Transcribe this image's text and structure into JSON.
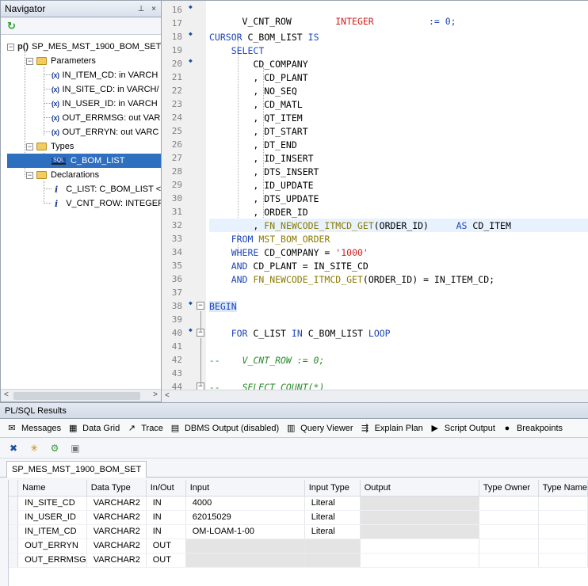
{
  "navigator": {
    "title": "Navigator",
    "pin_glyph": "⊥",
    "close_glyph": "×",
    "root": "SP_MES_MST_1900_BOM_SET",
    "root_icon": "p()",
    "param_icon": "(x)",
    "sql_icon": "SQL",
    "info_icon": "i",
    "parameters_label": "Parameters",
    "params": [
      "IN_ITEM_CD: in VARCH",
      "IN_SITE_CD: in VARCH/",
      "IN_USER_ID: in VARCH",
      "OUT_ERRMSG: out VAR",
      "OUT_ERRYN: out VARC"
    ],
    "types_label": "Types",
    "type_item": "C_BOM_LIST",
    "declarations_label": "Declarations",
    "decls": [
      "C_LIST: C_BOM_LIST <",
      "V_CNT_ROW: INTEGER"
    ]
  },
  "editor": {
    "lines": [
      {
        "n": "16",
        "bp": true
      },
      {
        "n": "17"
      },
      {
        "n": "18",
        "bp": true
      },
      {
        "n": "19"
      },
      {
        "n": "20",
        "bp": true
      },
      {
        "n": "21"
      },
      {
        "n": "22"
      },
      {
        "n": "23"
      },
      {
        "n": "24"
      },
      {
        "n": "25"
      },
      {
        "n": "26"
      },
      {
        "n": "27"
      },
      {
        "n": "28"
      },
      {
        "n": "29"
      },
      {
        "n": "30"
      },
      {
        "n": "31"
      },
      {
        "n": "32"
      },
      {
        "n": "33"
      },
      {
        "n": "34"
      },
      {
        "n": "35"
      },
      {
        "n": "36"
      },
      {
        "n": "37"
      },
      {
        "n": "38",
        "bp": true,
        "fold": "-"
      },
      {
        "n": "39"
      },
      {
        "n": "40",
        "bp": true,
        "fold": "-"
      },
      {
        "n": "41"
      },
      {
        "n": "42"
      },
      {
        "n": "43"
      },
      {
        "n": "44",
        "fold": "-"
      }
    ],
    "code": {
      "l16_var": "V_CNT_ROW",
      "l16_type": "INTEGER",
      "l16_assign": ":= 0;",
      "l18_kw": "CURSOR",
      "l18_name": "C_BOM_LIST",
      "l18_is": "IS",
      "l19": "SELECT",
      "l20": "CD_COMPANY",
      "cols": [
        ", CD_PLANT",
        ", NO_SEQ",
        ", CD_MATL",
        ", QT_ITEM",
        ", DT_START",
        ", DT_END",
        ", ID_INSERT",
        ", DTS_INSERT",
        ", ID_UPDATE",
        ", DTS_UPDATE",
        ", ORDER_ID"
      ],
      "l32_comma": ",",
      "l32_fn": "FN_NEWCODE_ITMCD_GET",
      "l32_arg": "(ORDER_ID)",
      "l32_as": "AS",
      "l32_alias": "CD_ITEM",
      "l33_kw": "FROM",
      "l33_tbl": "MST_BOM_ORDER",
      "l34_kw": "WHERE",
      "l34_col": "CD_COMPANY =",
      "l34_val": "'1000'",
      "l35_kw": "AND",
      "l35_rest": "CD_PLANT = IN_SITE_CD",
      "l36_kw": "AND",
      "l36_fn": "FN_NEWCODE_ITMCD_GET",
      "l36_rest": "(ORDER_ID) = IN_ITEM_CD;",
      "l38": "BEGIN",
      "l40_for": "FOR",
      "l40_mid": "C_LIST",
      "l40_in": "IN",
      "l40_cur": "C_BOM_LIST",
      "l40_loop": "LOOP",
      "l42": "--    V_CNT_ROW := 0;",
      "l44": "--    SELECT COUNT(*)"
    }
  },
  "results": {
    "title": "PL/SQL Results",
    "tabs": [
      {
        "icon": "messages-icon",
        "glyph": "✉",
        "label": "Messages"
      },
      {
        "icon": "data-grid-icon",
        "glyph": "▦",
        "label": "Data Grid"
      },
      {
        "icon": "trace-icon",
        "glyph": "↗",
        "label": "Trace"
      },
      {
        "icon": "dbms-output-icon",
        "glyph": "▤",
        "label": "DBMS Output (disabled)"
      },
      {
        "icon": "query-viewer-icon",
        "glyph": "▥",
        "label": "Query Viewer"
      },
      {
        "icon": "explain-plan-icon",
        "glyph": "⇶",
        "label": "Explain Plan"
      },
      {
        "icon": "script-output-icon",
        "glyph": "▶",
        "label": "Script Output"
      },
      {
        "icon": "breakpoints-icon",
        "glyph": "●",
        "label": "Breakpoints"
      }
    ],
    "toolbar": [
      {
        "icon": "execute-icon",
        "glyph": "✖"
      },
      {
        "icon": "new-icon",
        "glyph": "✳"
      },
      {
        "icon": "import-icon",
        "glyph": "⚙"
      },
      {
        "icon": "export-icon",
        "glyph": "▣"
      }
    ],
    "proc_tab": "SP_MES_MST_1900_BOM_SET",
    "columns": [
      "Name",
      "Data Type",
      "In/Out",
      "Input",
      "Input Type",
      "Output",
      "Type Owner",
      "Type Name"
    ],
    "rows": [
      {
        "name": "IN_SITE_CD",
        "dtype": "VARCHAR2",
        "inout": "IN",
        "input": "4000",
        "itype": "Literal",
        "output": "",
        "owner": "",
        "tname": ""
      },
      {
        "name": "IN_USER_ID",
        "dtype": "VARCHAR2",
        "inout": "IN",
        "input": "62015029",
        "itype": "Literal",
        "output": "",
        "owner": "",
        "tname": ""
      },
      {
        "name": "IN_ITEM_CD",
        "dtype": "VARCHAR2",
        "inout": "IN",
        "input": "OM-LOAM-1-00",
        "itype": "Literal",
        "output": "",
        "owner": "",
        "tname": ""
      },
      {
        "name": "OUT_ERRYN",
        "dtype": "VARCHAR2",
        "inout": "OUT",
        "input": "",
        "itype": "",
        "output": "",
        "owner": "",
        "tname": ""
      },
      {
        "name": "OUT_ERRMSG",
        "dtype": "VARCHAR2",
        "inout": "OUT",
        "input": "",
        "itype": "",
        "output": "",
        "owner": "",
        "tname": ""
      }
    ]
  }
}
